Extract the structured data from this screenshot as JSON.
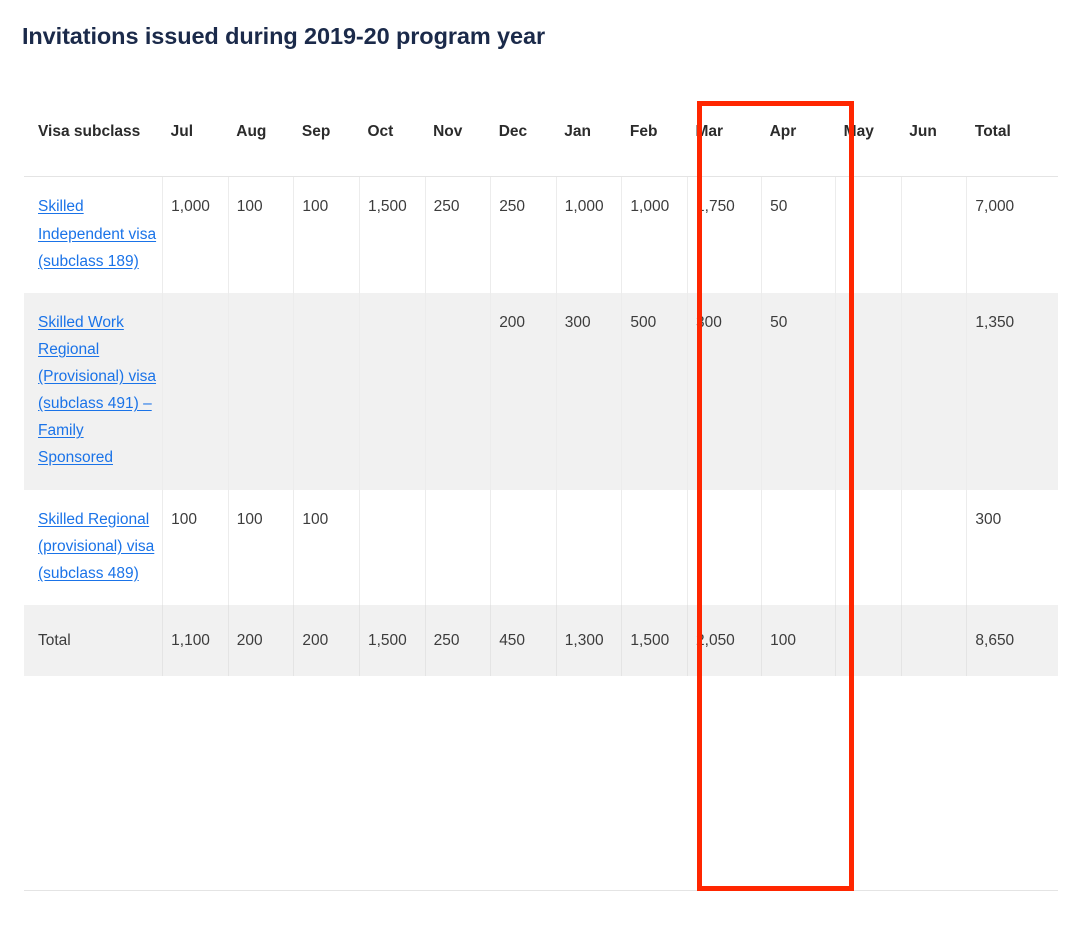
{
  "document": {
    "title": "Invitations issued during 2019-20 program year"
  },
  "colors": {
    "title": "#1b2a4a",
    "link": "#1a73e8",
    "annotation": "#ff2600",
    "shaded_row": "#f1f1f1",
    "border": "#ececec",
    "text": "#3c3c3c"
  },
  "annotation": {
    "type": "rectangle-highlight",
    "color": "#ff2600",
    "covers_columns": [
      "Mar",
      "Apr"
    ]
  },
  "table": {
    "columns": [
      "Visa subclass",
      "Jul",
      "Aug",
      "Sep",
      "Oct",
      "Nov",
      "Dec",
      "Jan",
      "Feb",
      "Mar",
      "Apr",
      "May",
      "Jun",
      "Total"
    ],
    "rows": [
      {
        "label": "Skilled Independent visa (subclass 189)",
        "is_link": true,
        "shaded": false,
        "values": [
          "1,000",
          "100",
          "100",
          "1,500",
          "250",
          "250",
          "1,000",
          "1,000",
          "1,750",
          "50",
          "",
          "",
          "7,000"
        ]
      },
      {
        "label": "Skilled Work Regional (Provisional) visa (subclass 491) – Family Sponsored",
        "is_link": true,
        "shaded": true,
        "values": [
          "",
          "",
          "",
          "",
          "",
          "200",
          "300",
          "500",
          "300",
          "50",
          "",
          "",
          "1,350"
        ]
      },
      {
        "label": "Skilled Regional (provisional) visa (subclass 489)",
        "is_link": true,
        "shaded": false,
        "values": [
          "100",
          "100",
          "100",
          "",
          "",
          "",
          "",
          "",
          "",
          "",
          "",
          "",
          "300"
        ]
      }
    ],
    "total_row": {
      "label": "Total",
      "is_link": false,
      "shaded": true,
      "values": [
        "1,100",
        "200",
        "200",
        "1,500",
        "250",
        "450",
        "1,300",
        "1,500",
        "2,050",
        "100",
        "",
        "",
        "8,650"
      ]
    }
  }
}
